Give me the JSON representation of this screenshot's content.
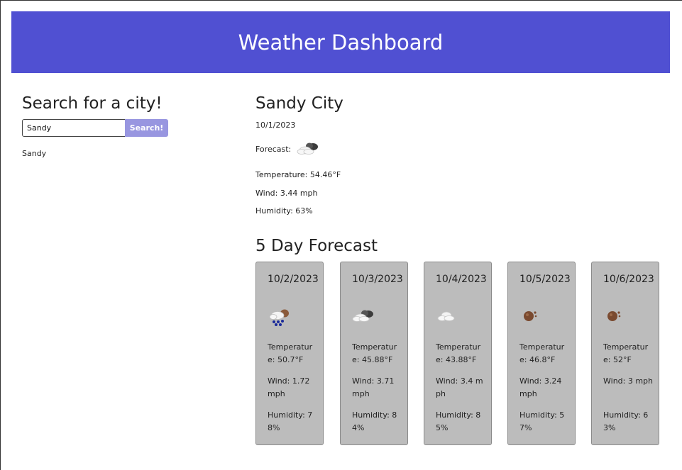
{
  "header": {
    "title": "Weather Dashboard"
  },
  "search": {
    "title": "Search for a city!",
    "value": "Sandy",
    "button_label": "Search!",
    "history": [
      "Sandy"
    ]
  },
  "current": {
    "city": "Sandy City",
    "date": "10/1/2023",
    "forecast_label": "Forecast:",
    "icon": "cloudy-icon",
    "temperature": "Temperature: 54.46°F",
    "wind": "Wind: 3.44 mph",
    "humidity": "Humidity: 63%"
  },
  "five_day": {
    "title": "5 Day Forecast",
    "days": [
      {
        "date": "10/2/2023",
        "icon": "snow-icon",
        "temperature": "Temperature: 50.7°F",
        "wind": "Wind: 1.72 mph",
        "humidity": "Humidity: 78%"
      },
      {
        "date": "10/3/2023",
        "icon": "cloudy-icon",
        "temperature": "Temperature: 45.88°F",
        "wind": "Wind: 3.71 mph",
        "humidity": "Humidity: 84%"
      },
      {
        "date": "10/4/2023",
        "icon": "cloud-icon",
        "temperature": "Temperature: 43.88°F",
        "wind": "Wind: 3.4 mph",
        "humidity": "Humidity: 85%"
      },
      {
        "date": "10/5/2023",
        "icon": "dust-icon",
        "temperature": "Temperature: 46.8°F",
        "wind": "Wind: 3.24 mph",
        "humidity": "Humidity: 57%"
      },
      {
        "date": "10/6/2023",
        "icon": "dust-icon",
        "temperature": "Temperature: 52°F",
        "wind": "Wind: 3 mph",
        "humidity": "Humidity: 63%"
      }
    ]
  }
}
